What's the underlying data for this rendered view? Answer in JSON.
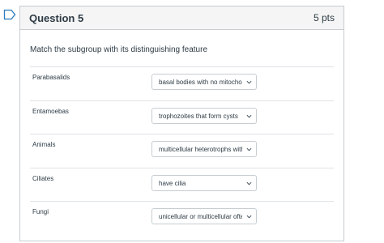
{
  "question": {
    "title": "Question 5",
    "points": "5 pts",
    "prompt": "Match the subgroup with its distinguishing feature"
  },
  "matches": [
    {
      "label": "Parabasalids",
      "selected": "basal bodies with no mitochondria"
    },
    {
      "label": "Entamoebas",
      "selected": "trophozoites that form cysts"
    },
    {
      "label": "Animals",
      "selected": "multicellular heterotrophs with"
    },
    {
      "label": "Ciliates",
      "selected": "have cilia"
    },
    {
      "label": "Fungi",
      "selected": "unicellular or multicellular often"
    }
  ],
  "icons": {
    "flag": "bookmark-flag-icon",
    "dropdown": "chevron-down-icon"
  },
  "colors": {
    "flag": "#2b7abc",
    "border": "#c7cdd1",
    "text": "#2d3b45"
  }
}
